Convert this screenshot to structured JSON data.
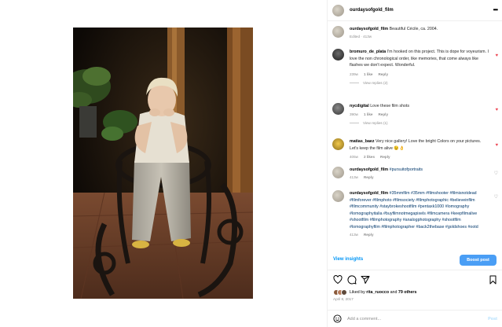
{
  "post": {
    "username": "ourdaysofgold_film"
  },
  "caption": {
    "username": "ourdaysofgold_film",
    "text": "Beautiful Cécile, ca. 2004.",
    "meta": "Edited · 413w"
  },
  "comments": [
    {
      "username": "bromuro_de_plata",
      "text": "I'm hooked on this project. This is dope for voyeurism. I love the non chronological order, like memories, that come always like flashes we don't expect. Wonderful.",
      "age": "239w",
      "likes": "1 like",
      "reply": "Reply",
      "view_replies": "View replies (2)",
      "liked": true
    },
    {
      "username": "nycdigital",
      "text": "Love these film shots",
      "age": "390w",
      "likes": "1 like",
      "reply": "Reply",
      "view_replies": "View replies (1)",
      "liked": true
    },
    {
      "username": "matias_baez",
      "text": "Very nice gallery! Love the bright Colors on your pictures. Let's keep the film alive 😉👌",
      "age": "405w",
      "likes": "2 likes",
      "reply": "Reply",
      "liked": true
    },
    {
      "username": "ourdaysofgold_film",
      "text": "#pursuitofportraits",
      "age": "413w",
      "reply": "Reply",
      "liked": false
    },
    {
      "username": "ourdaysofgold_film",
      "text": "#35mmfilm #35mm #filmshooter #filmisnotdead #filmforever #filmphoto #filmsociety #filmphotographic #believeinfilm #filmcommunity #staybrokeshootfilm #pentaxk1000 #lomography #lomographyitalia #buyfilmnotmegapixels #filmcamera #keepfilmalive #shootfilm #filmphotography #analogphotography #shootfilm #lomographyfilm #filmphotographer #back2thebase #goldshoes #ootd",
      "age": "413w",
      "reply": "Reply",
      "liked": false
    }
  ],
  "view_insights": "View insights",
  "boost_post": "Boost post",
  "likes": {
    "prefix": "Liked by",
    "user": "rita_ruocco",
    "and": "and",
    "others": "79 others"
  },
  "date": "April 8, 2017",
  "add_comment": {
    "placeholder": "Add a comment...",
    "post_label": "Post"
  },
  "icons": {
    "more": "more-options-icon",
    "like": "heart-icon",
    "comment": "comment-icon",
    "share": "share-icon",
    "save": "bookmark-icon",
    "emoji": "emoji-icon"
  },
  "colors": {
    "link": "#0095f6",
    "hashtag": "#00376b",
    "heart": "#ed4956",
    "boost": "#4a9ef5",
    "muted": "#8e8e8e"
  }
}
